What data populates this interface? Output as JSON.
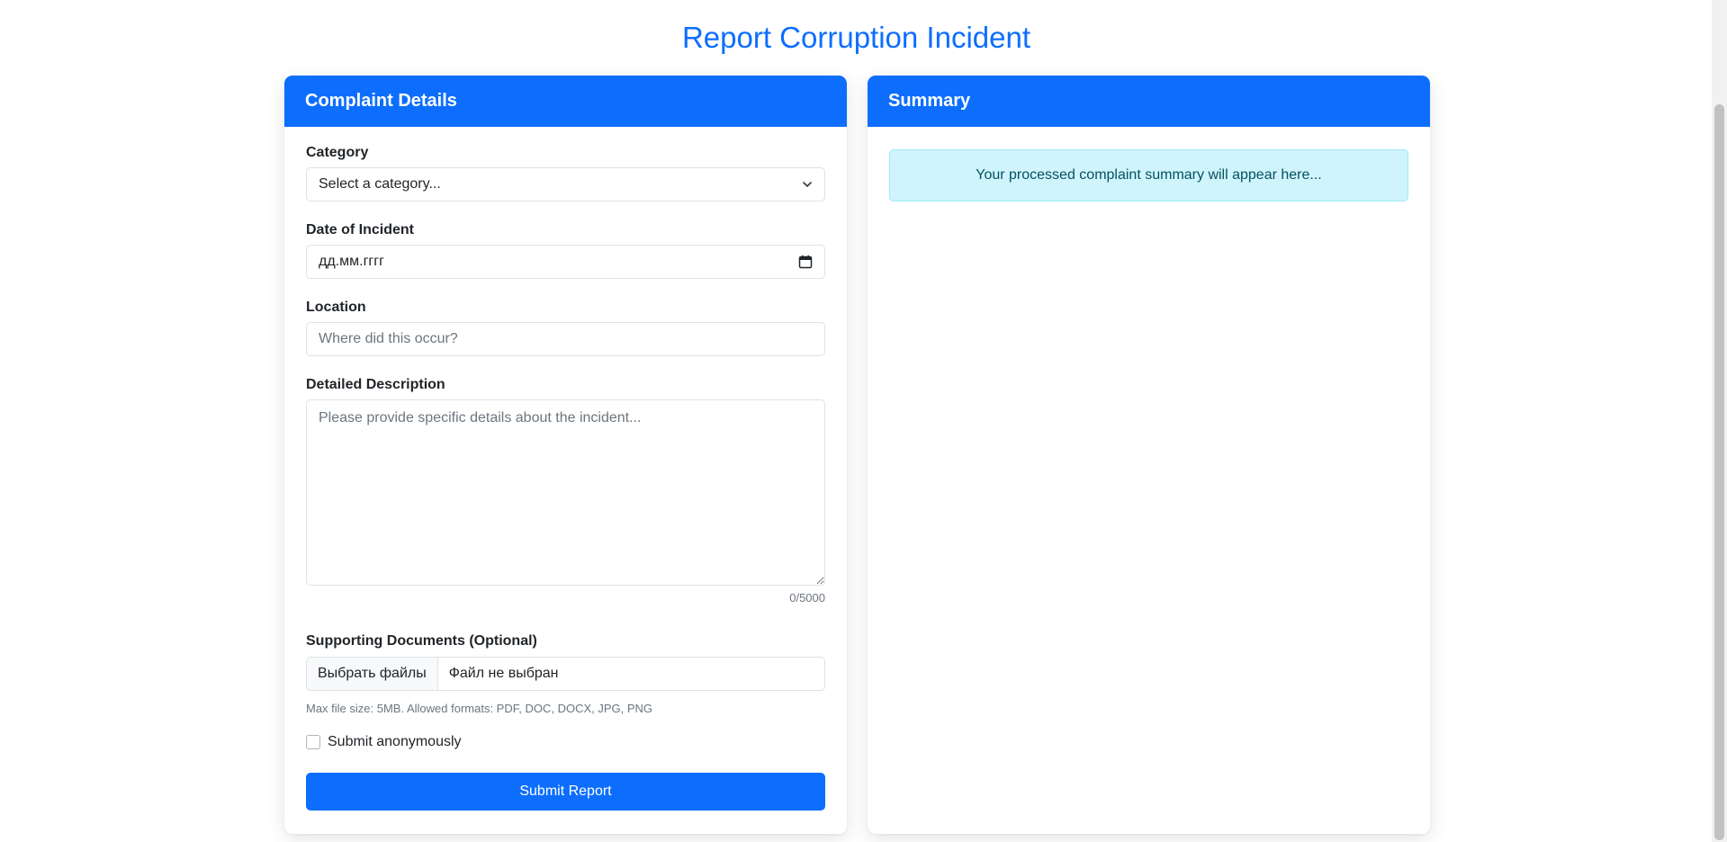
{
  "page": {
    "title": "Report Corruption Incident"
  },
  "form": {
    "header": "Complaint Details",
    "category": {
      "label": "Category",
      "value": "Select a category..."
    },
    "date": {
      "label": "Date of Incident",
      "placeholder": "дд.мм.гггг"
    },
    "location": {
      "label": "Location",
      "placeholder": "Where did this occur?"
    },
    "description": {
      "label": "Detailed Description",
      "placeholder": "Please provide specific details about the incident...",
      "counter": "0/5000"
    },
    "documents": {
      "label": "Supporting Documents (Optional)",
      "button": "Выбрать файлы",
      "file_status": "Файл не выбран",
      "hint": "Max file size: 5MB. Allowed formats: PDF, DOC, DOCX, JPG, PNG"
    },
    "anonymous_label": "Submit anonymously",
    "submit_label": "Submit Report"
  },
  "summary": {
    "header": "Summary",
    "placeholder_text": "Your processed complaint summary will appear here..."
  },
  "colors": {
    "primary": "#0d6efd",
    "info_bg": "#cff4fc",
    "info_text": "#055160"
  }
}
